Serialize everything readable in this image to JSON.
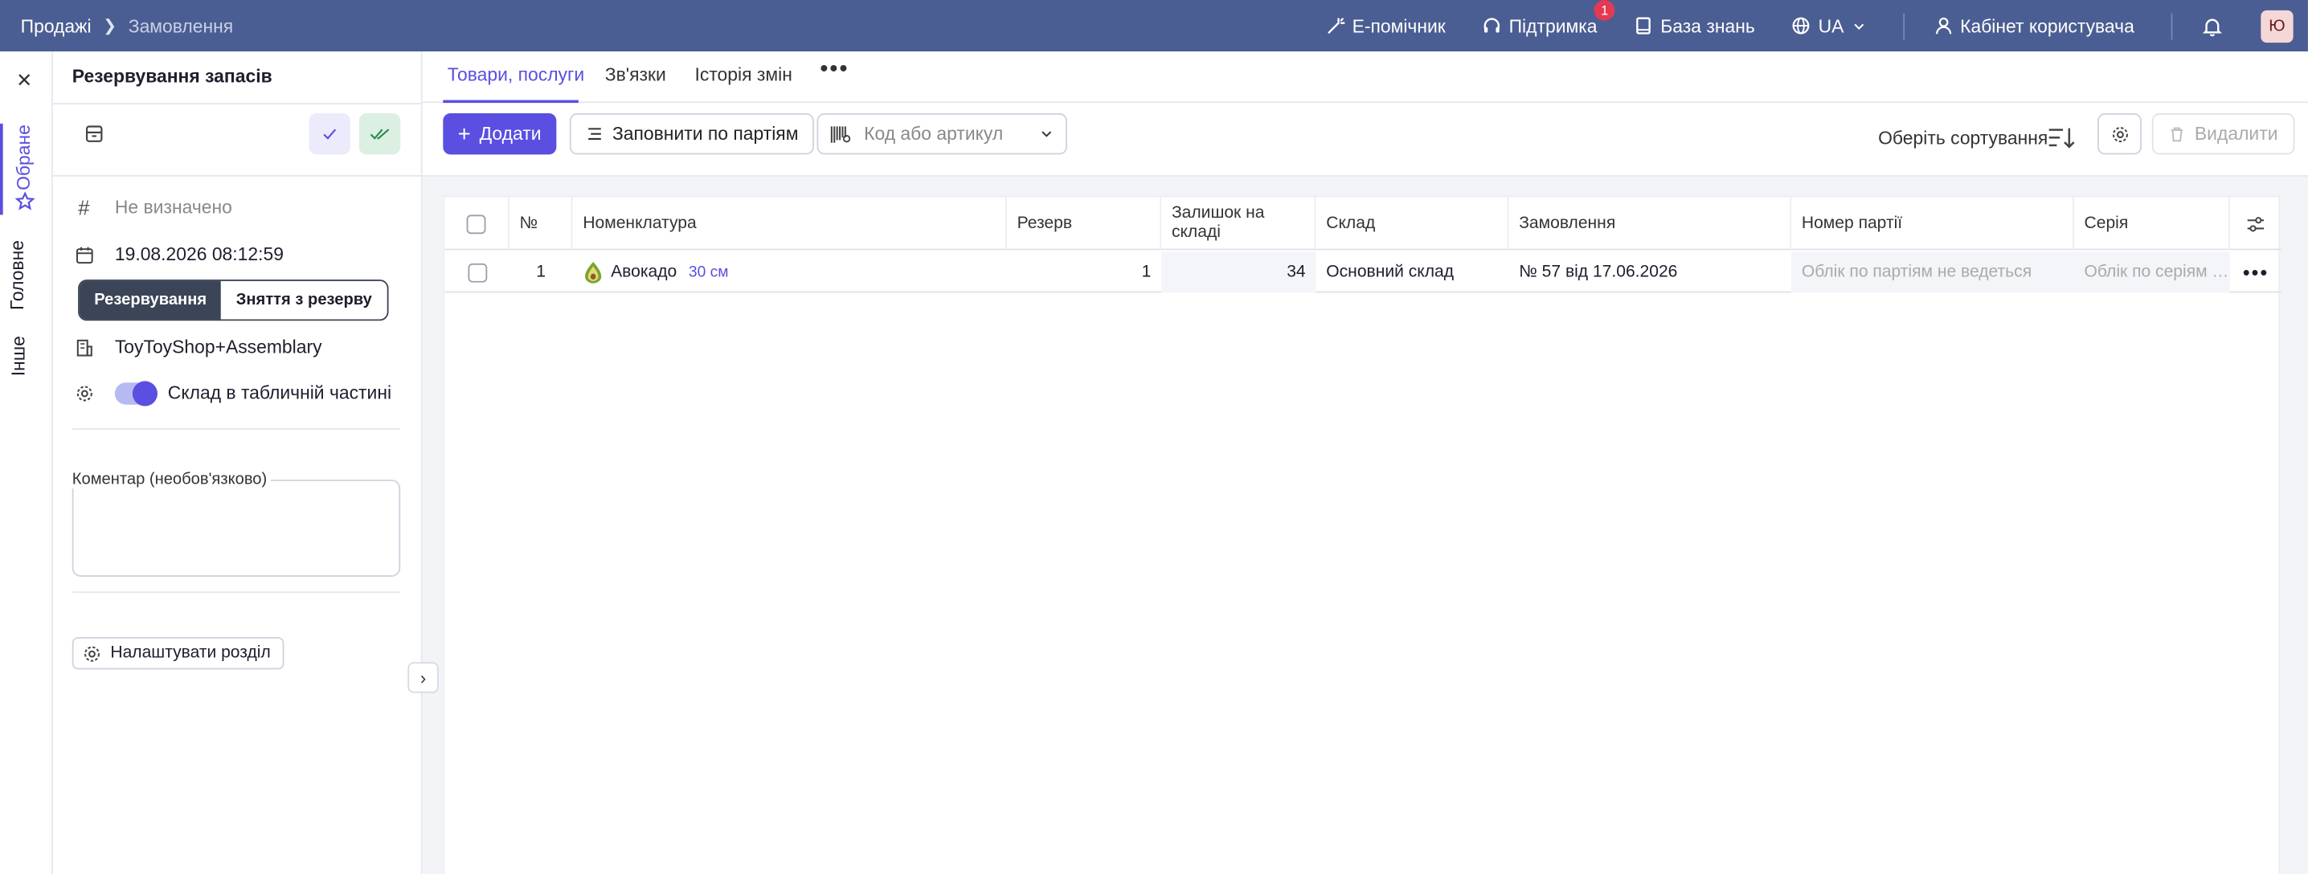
{
  "breadcrumbs": [
    "Продажі",
    "Замовлення"
  ],
  "topbar": {
    "assistant": "Е-помічник",
    "support": "Підтримка",
    "support_badge": "1",
    "knowledge": "База знань",
    "lang": "UA",
    "cabinet": "Кабінет користувача",
    "avatar": "Ю"
  },
  "rail": {
    "fav": "Обране",
    "main": "Головне",
    "other": "Інше"
  },
  "panel": {
    "title": "Резервування запасів",
    "number_placeholder": "Не визначено",
    "date": "19.08.2026 08:12:59",
    "seg_reserve": "Резервування",
    "seg_unreserve": "Зняття з резерву",
    "organization": "ToyToyShop+Assemblary",
    "warehouse_toggle_label": "Склад в табличній частині",
    "comment_label": "Коментар (необов'язково)",
    "configure": "Налаштувати розділ"
  },
  "tabs": [
    "Товари, послуги",
    "Зв'язки",
    "Історія змін"
  ],
  "toolbar": {
    "add": "Додати",
    "fill_by_batches": "Заповнити по партіям",
    "search_placeholder": "Код або артикул",
    "sort": "Оберіть сортування",
    "delete": "Видалити"
  },
  "table": {
    "headers": [
      "№",
      "Номенклатура",
      "Резерв",
      "Залишок на складі",
      "Склад",
      "Замовлення",
      "Номер партії",
      "Серія"
    ],
    "rows": [
      {
        "no": "1",
        "name": "Авокадо",
        "size": "30 см",
        "reserve": "1",
        "stock": "34",
        "warehouse": "Основний склад",
        "order": "№ 57 від 17.06.2026",
        "batch": "Облік по партіям не ведеться",
        "series": "Облік по серіям …"
      }
    ]
  },
  "colors": {
    "topbar": "#4b5e93",
    "accent": "#5a4fe0",
    "danger_badge": "#e53953"
  }
}
